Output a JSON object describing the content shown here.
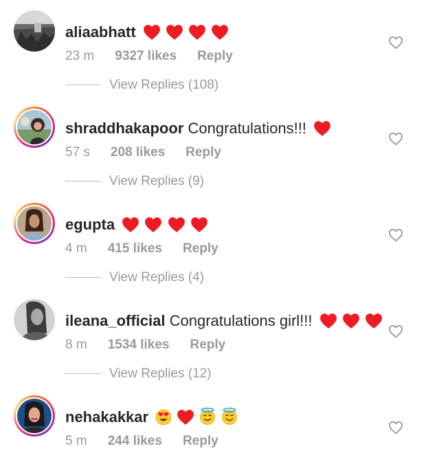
{
  "comments": [
    {
      "username": "aliaabhatt",
      "text": "",
      "emojis": [
        "red-heart",
        "red-heart",
        "red-heart",
        "red-heart"
      ],
      "time": "23 m",
      "likes": "9327 likes",
      "reply": "Reply",
      "view_replies": "View Replies (108)",
      "avatar_story_ring": false
    },
    {
      "username": "shraddhakapoor",
      "text": " Congratulations!!!",
      "emojis": [
        "red-heart"
      ],
      "time": "57 s",
      "likes": "208 likes",
      "reply": "Reply",
      "view_replies": "View Replies (9)",
      "avatar_story_ring": true
    },
    {
      "username": "egupta",
      "text": "",
      "emojis": [
        "red-heart",
        "red-heart",
        "red-heart",
        "red-heart"
      ],
      "time": "4 m",
      "likes": "415 likes",
      "reply": "Reply",
      "view_replies": "View Replies (4)",
      "avatar_story_ring": true
    },
    {
      "username": "ileana_official",
      "text": " Congratulations girl!!!",
      "emojis": [
        "red-heart",
        "red-heart",
        "red-heart"
      ],
      "time": "8 m",
      "likes": "1534 likes",
      "reply": "Reply",
      "view_replies": "View Replies (12)",
      "avatar_story_ring": false
    },
    {
      "username": "nehakakkar",
      "text": "",
      "emojis": [
        "heart-eyes",
        "red-heart",
        "smiling-halo",
        "smiling-halo"
      ],
      "time": "5 m",
      "likes": "244 likes",
      "reply": "Reply",
      "view_replies": "",
      "avatar_story_ring": true
    }
  ],
  "colors": {
    "username": "#262626",
    "meta": "#999999",
    "heart_red": "#ed1c24",
    "like_outline": "#8e8e8e",
    "divider": "#bdbdbd"
  },
  "icons": {
    "like": "heart-outline-icon",
    "emoji_heart": "red-heart-emoji",
    "emoji_heart_eyes": "heart-eyes-emoji",
    "emoji_halo": "smiling-halo-emoji"
  }
}
